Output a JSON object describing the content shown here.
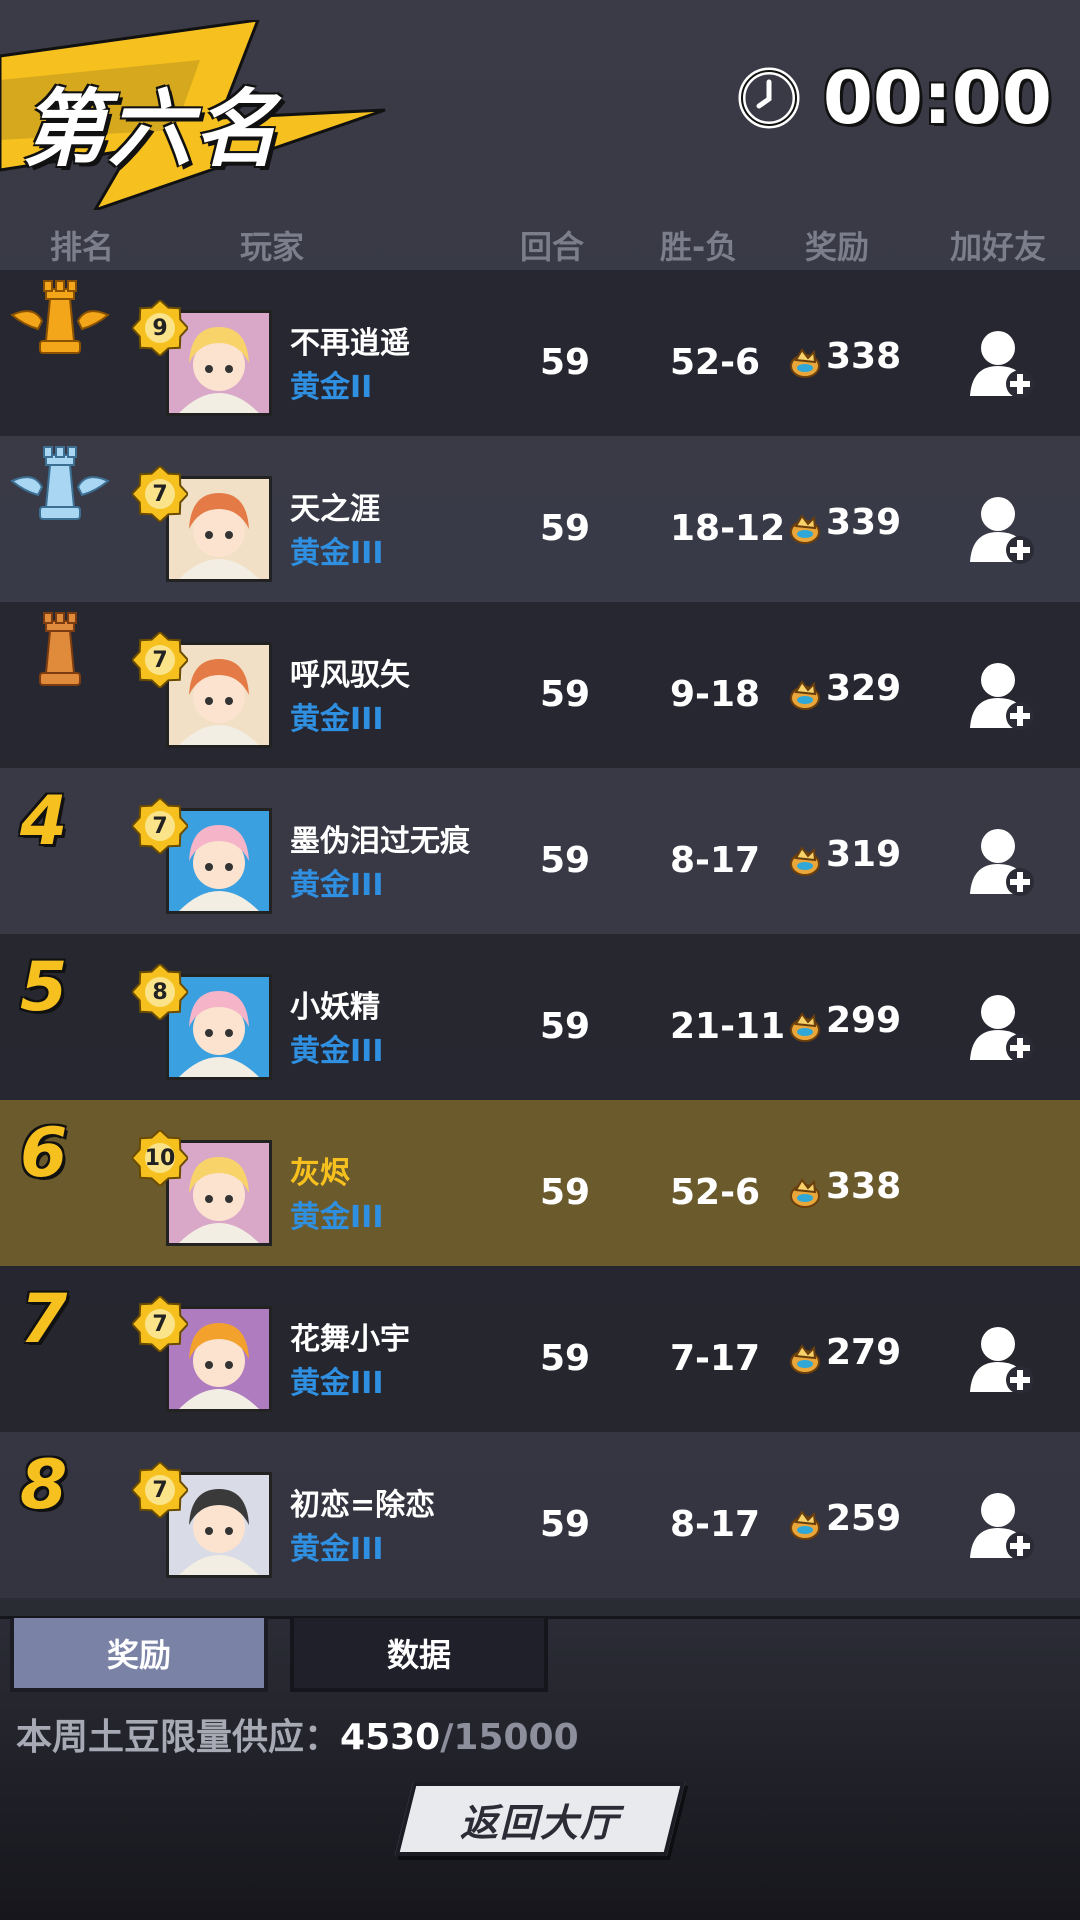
{
  "header": {
    "rank_title": "第六名",
    "timer": "00:00"
  },
  "columns": {
    "rank": "排名",
    "player": "玩家",
    "rounds": "回合",
    "win_loss": "胜-负",
    "reward": "奖励",
    "add_friend": "加好友"
  },
  "colors": {
    "gold": "#f6c11f",
    "tier_blue": "#2f8fe0",
    "highlight_row": "#6b5a2c"
  },
  "players": [
    {
      "rank": "1",
      "rank_icon": "gold-rook-trophy-icon",
      "level": "9",
      "avatar": "blonde-cat-ear-girl",
      "name": "不再逍遥",
      "tier": "黄金II",
      "rounds": "59",
      "win_loss": "52-6",
      "reward": "338",
      "can_add": true
    },
    {
      "rank": "2",
      "rank_icon": "silver-rook-trophy-icon",
      "level": "7",
      "avatar": "orange-hair-boy",
      "name": "天之涯",
      "tier": "黄金III",
      "rounds": "59",
      "win_loss": "18-12",
      "reward": "339",
      "can_add": true
    },
    {
      "rank": "3",
      "rank_icon": "bronze-rook-trophy-icon",
      "level": "7",
      "avatar": "orange-hair-boy",
      "name": "呼风驭矢",
      "tier": "黄金III",
      "rounds": "59",
      "win_loss": "9-18",
      "reward": "329",
      "can_add": true
    },
    {
      "rank": "4",
      "level": "7",
      "avatar": "pink-hair-girl-beach",
      "name": "墨伪泪过无痕",
      "tier": "黄金III",
      "rounds": "59",
      "win_loss": "8-17",
      "reward": "319",
      "can_add": true
    },
    {
      "rank": "5",
      "level": "8",
      "avatar": "pink-hair-girl-beach",
      "name": "小妖精",
      "tier": "黄金III",
      "rounds": "59",
      "win_loss": "21-11",
      "reward": "299",
      "can_add": true
    },
    {
      "rank": "6",
      "level": "10",
      "avatar": "blonde-cat-ear-girl",
      "name": "灰烬",
      "tier": "黄金III",
      "rounds": "59",
      "win_loss": "52-6",
      "reward": "338",
      "can_add": false,
      "is_me": true
    },
    {
      "rank": "7",
      "level": "7",
      "avatar": "orange-twin-tail-girl",
      "name": "花舞小宇",
      "tier": "黄金III",
      "rounds": "59",
      "win_loss": "7-17",
      "reward": "279",
      "can_add": true
    },
    {
      "rank": "8",
      "level": "7",
      "avatar": "hooded-white-hair-girl",
      "name": "初恋=除恋",
      "tier": "黄金III",
      "rounds": "59",
      "win_loss": "8-17",
      "reward": "259",
      "can_add": true
    }
  ],
  "tabs": [
    {
      "label": "奖励",
      "active": true
    },
    {
      "label": "数据",
      "active": false
    }
  ],
  "supply": {
    "label": "本周土豆限量供应：",
    "current": "4530",
    "total": "/15000"
  },
  "back_button": "返回大厅"
}
